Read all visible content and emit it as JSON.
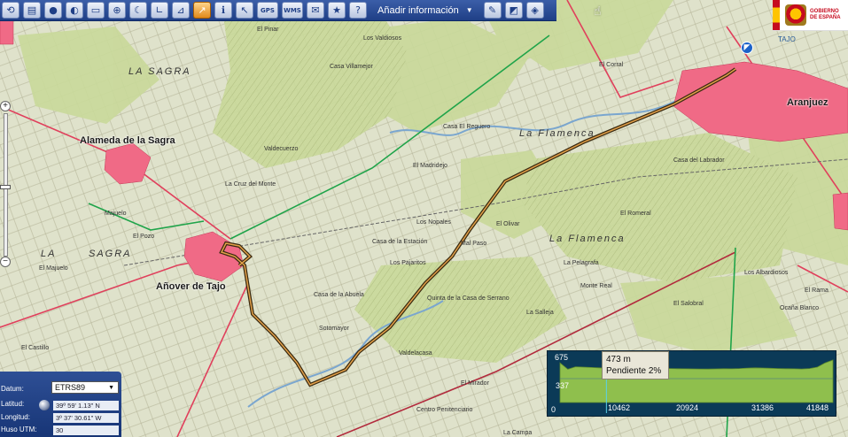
{
  "toolbar": {
    "add_info_label": "Añadir información",
    "gps_label": "GPS",
    "wms_label": "WMS",
    "icons": [
      "reload-icon",
      "print-icon",
      "sphere-icon",
      "globe-icon",
      "layers-icon",
      "zoom-box-icon",
      "moon-icon",
      "measure-icon",
      "distance-icon",
      "area-icon",
      "info-icon",
      "pointer-icon",
      "gps-icon",
      "wms-icon",
      "email-icon",
      "star-icon",
      "help-icon",
      "draw-icon",
      "3d-icon",
      "export-icon"
    ]
  },
  "logo": {
    "line1": "GOBIERNO",
    "line2": "DE ESPAÑA"
  },
  "map": {
    "places": {
      "alameda": "Alameda de la Sagra",
      "anover": "Añover de Tajo",
      "aranjuez": "Aranjuez",
      "la_sagra_top": "LA SAGRA",
      "la_sagra_left": "LA",
      "sagra_left": "SAGRA",
      "la_flamenca_1": "La Flamenca",
      "la_flamenca_2": "La Flamenca",
      "tajo": "TAJO",
      "el_madridejo": "El Madridejo",
      "los_pajaritos": "Los Pajaritos",
      "el_salobral": "El Salobral",
      "la_estacion": "Casa de la Estación",
      "el_corral": "El Corral",
      "el_romeral": "El Romeral",
      "la_pelagrafa": "La Pelagrafa",
      "monte_real": "Monte Real",
      "casa_valdecuerzo": "Valdecuerzo",
      "labrador": "Casa del Labrador",
      "la_abuela": "Casa de la Abuela",
      "los_nopales": "Los Nopales",
      "mal_paso": "Mal Paso",
      "el_reguero": "Casa El Reguero",
      "el_olivar": "El Olivar",
      "la_cruz": "La Cruz del Monte",
      "los_valdiosos": "Los Valdiosos",
      "villamejor": "Casa Villamejor",
      "el_pinar": "El Pinar",
      "sotomayor": "Sotomayor",
      "los_albardiosos": "Los Albardiosos",
      "el_rama": "El Rama",
      "quinta": "Quinta de la Casa de Serrano",
      "la_salleja": "La Salleja",
      "el_majuelo": "El Majuelo",
      "valdelacasa": "Valdelacasa",
      "penitenciaria": "Centro Penitenciario",
      "el_mirador": "El Mirador",
      "la_campa": "La Campa",
      "ocana": "Ocaña Blanco",
      "el_pozo": "El Pozo",
      "el_castillo": "El Castillo",
      "majuelo_bajo": "Majuelo"
    }
  },
  "coords": {
    "datum_label": "Datum:",
    "datum_value": "ETRS89",
    "lat_label": "Latitud:",
    "lat_value": "39º 59' 1.13\" N",
    "lon_label": "Longitud:",
    "lon_value": "3º 37' 30.61\" W",
    "huso_label": "Huso UTM:",
    "huso_value": "30"
  },
  "profile": {
    "y_max": "675",
    "y_mid": "337",
    "y_min": "0",
    "x_ticks": [
      "10462",
      "20924",
      "31386",
      "41848"
    ],
    "tooltip_elevation": "473 m",
    "tooltip_slope": "Pendiente 2%",
    "elevation_series": [
      560,
      470,
      505,
      500,
      495,
      490,
      485,
      488,
      480,
      482,
      478,
      476,
      479,
      484,
      480,
      478,
      476,
      475,
      474,
      473,
      475,
      478,
      476,
      480,
      486,
      490,
      488,
      484,
      480,
      478,
      476,
      474,
      480,
      500,
      560,
      600
    ],
    "cursor_fraction": 0.17
  },
  "colors": {
    "toolbar": "#1f3f86",
    "route": "#c07a1c",
    "urban": "#e84a6a",
    "profile_fill": "#8fbf4d",
    "profile_bg": "#0b3a57"
  }
}
